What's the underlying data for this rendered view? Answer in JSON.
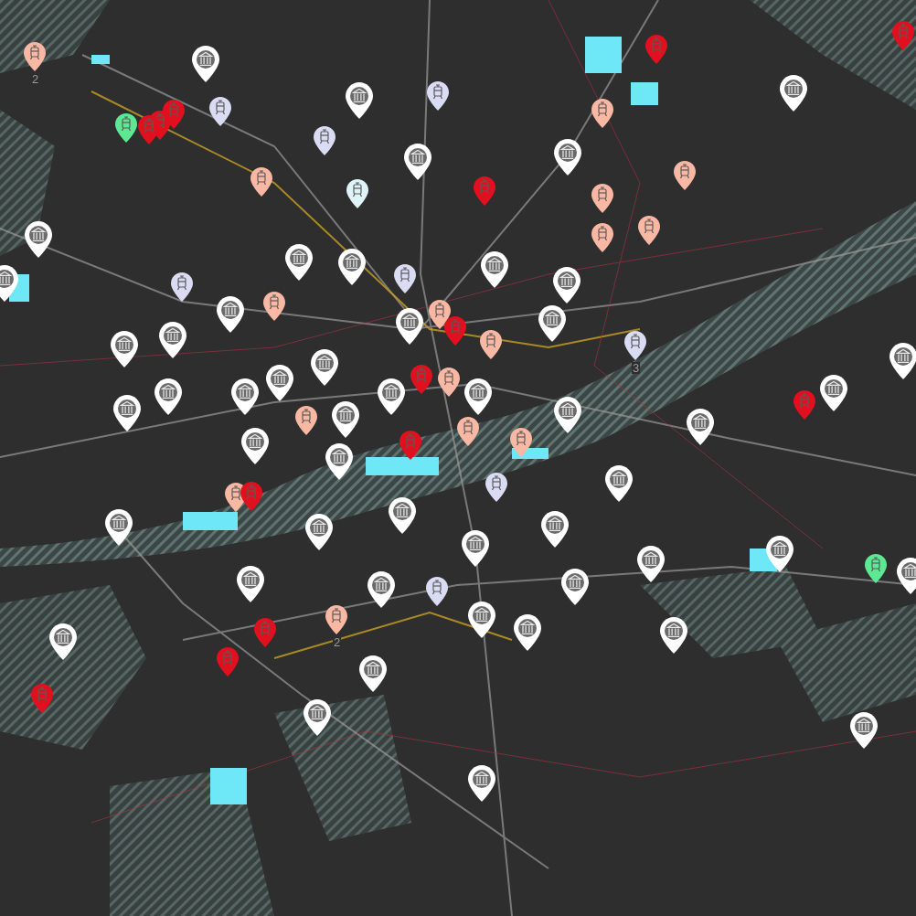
{
  "map": {
    "pins": [
      {
        "kind": "landmark"
      },
      {
        "kind": "landmark"
      },
      {
        "kind": "landmark"
      },
      {
        "kind": "landmark"
      },
      {
        "kind": "landmark"
      },
      {
        "kind": "landmark"
      },
      {
        "kind": "landmark"
      },
      {
        "kind": "landmark"
      },
      {
        "kind": "landmark"
      },
      {
        "kind": "landmark"
      },
      {
        "kind": "landmark"
      },
      {
        "kind": "landmark"
      },
      {
        "kind": "landmark"
      },
      {
        "kind": "landmark"
      },
      {
        "kind": "landmark"
      },
      {
        "kind": "landmark"
      },
      {
        "kind": "landmark"
      },
      {
        "kind": "landmark"
      },
      {
        "kind": "landmark"
      },
      {
        "kind": "landmark"
      },
      {
        "kind": "landmark"
      },
      {
        "kind": "landmark"
      },
      {
        "kind": "landmark"
      },
      {
        "kind": "landmark"
      },
      {
        "kind": "landmark"
      },
      {
        "kind": "landmark"
      },
      {
        "kind": "landmark"
      },
      {
        "kind": "landmark"
      },
      {
        "kind": "landmark"
      },
      {
        "kind": "landmark"
      },
      {
        "kind": "landmark"
      },
      {
        "kind": "landmark"
      },
      {
        "kind": "landmark"
      },
      {
        "kind": "landmark"
      },
      {
        "kind": "landmark"
      },
      {
        "kind": "landmark"
      },
      {
        "kind": "landmark"
      },
      {
        "kind": "landmark"
      },
      {
        "kind": "landmark"
      },
      {
        "kind": "landmark"
      },
      {
        "kind": "landmark"
      },
      {
        "kind": "landmark"
      },
      {
        "kind": "landmark"
      },
      {
        "kind": "landmark"
      },
      {
        "kind": "landmark"
      },
      {
        "kind": "landmark"
      },
      {
        "kind": "landmark"
      },
      {
        "kind": "landmark"
      },
      {
        "kind": "landmark"
      },
      {
        "kind": "landmark"
      },
      {
        "kind": "stop",
        "color": "#f9b8a4",
        "label": "2"
      },
      {
        "kind": "stop",
        "color": "#f9b8a4"
      },
      {
        "kind": "stop",
        "color": "#f9b8a4"
      },
      {
        "kind": "stop",
        "color": "#f9b8a4"
      },
      {
        "kind": "stop",
        "color": "#f9b8a4"
      },
      {
        "kind": "stop",
        "color": "#f9b8a4"
      },
      {
        "kind": "stop",
        "color": "#f9b8a4"
      },
      {
        "kind": "stop",
        "color": "#f9b8a4"
      },
      {
        "kind": "stop",
        "color": "#f9b8a4"
      },
      {
        "kind": "stop",
        "color": "#f9b8a4"
      },
      {
        "kind": "stop",
        "color": "#f9b8a4"
      },
      {
        "kind": "stop",
        "color": "#f9b8a4"
      },
      {
        "kind": "stop",
        "color": "#f9b8a4"
      },
      {
        "kind": "stop",
        "color": "#f9b8a4"
      },
      {
        "kind": "stop",
        "color": "#f9b8a4"
      },
      {
        "kind": "stop",
        "color": "#f9b8a4",
        "label": "2"
      },
      {
        "kind": "stop",
        "color": "#e0101e"
      },
      {
        "kind": "stop",
        "color": "#e0101e"
      },
      {
        "kind": "stop",
        "color": "#e0101e"
      },
      {
        "kind": "stop",
        "color": "#e0101e"
      },
      {
        "kind": "stop",
        "color": "#e0101e"
      },
      {
        "kind": "stop",
        "color": "#e0101e"
      },
      {
        "kind": "stop",
        "color": "#e0101e"
      },
      {
        "kind": "stop",
        "color": "#e0101e"
      },
      {
        "kind": "stop",
        "color": "#e0101e"
      },
      {
        "kind": "stop",
        "color": "#e0101e"
      },
      {
        "kind": "stop",
        "color": "#e0101e"
      },
      {
        "kind": "stop",
        "color": "#e0101e"
      },
      {
        "kind": "stop",
        "color": "#e0101e"
      },
      {
        "kind": "stop",
        "color": "#e0101e"
      },
      {
        "kind": "stop",
        "color": "#dadcf4"
      },
      {
        "kind": "stop",
        "color": "#dadcf4"
      },
      {
        "kind": "stop",
        "color": "#dadcf4"
      },
      {
        "kind": "stop",
        "color": "#dadcf4"
      },
      {
        "kind": "stop",
        "color": "#dadcf4"
      },
      {
        "kind": "stop",
        "color": "#dadcf4",
        "label": "3"
      },
      {
        "kind": "stop",
        "color": "#dadcf4"
      },
      {
        "kind": "stop",
        "color": "#dadcf4"
      },
      {
        "kind": "stop",
        "color": "#dff4f6"
      },
      {
        "kind": "stop",
        "color": "#5de894"
      },
      {
        "kind": "stop",
        "color": "#5de894"
      }
    ]
  }
}
